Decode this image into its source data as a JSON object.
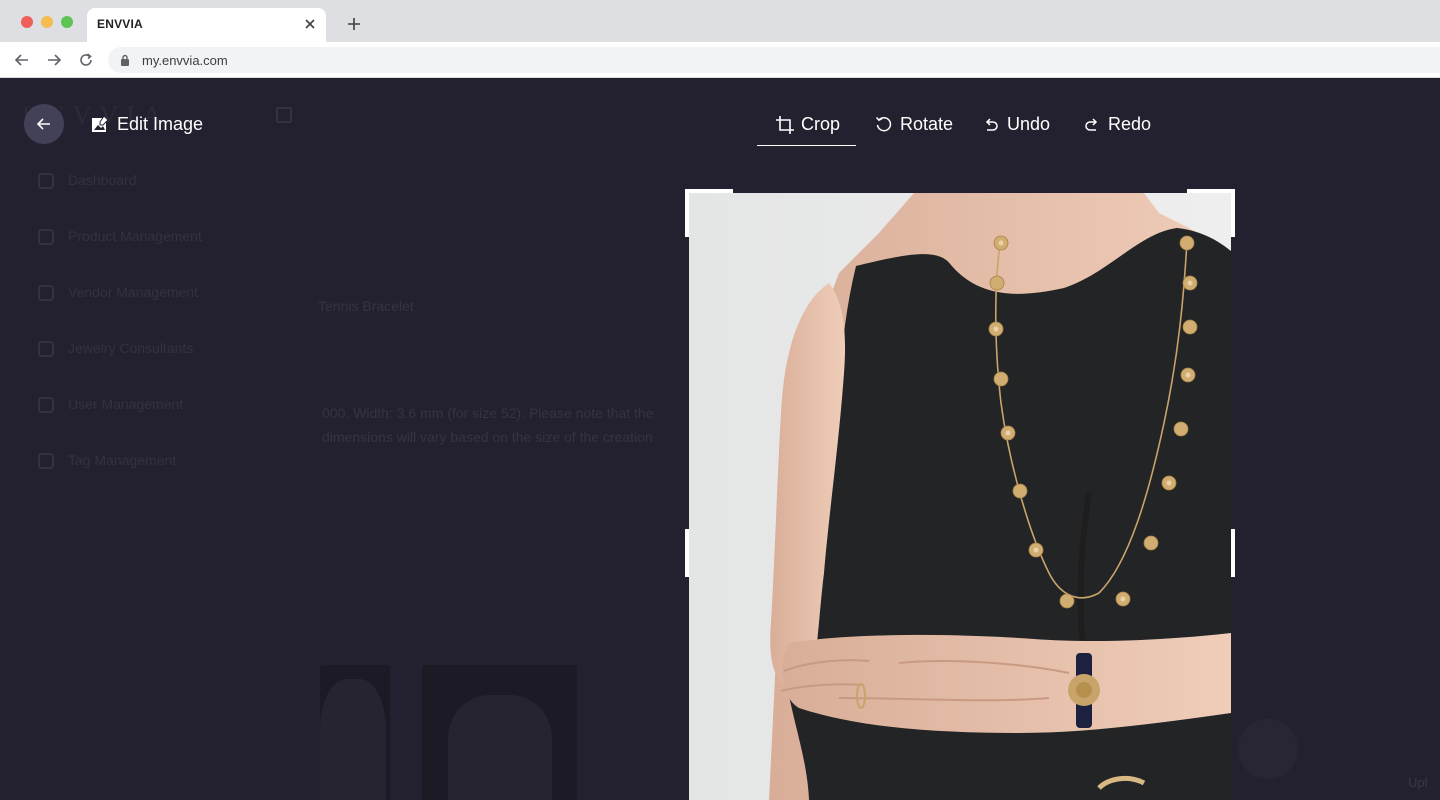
{
  "browser": {
    "tab_title": "ENVVIA",
    "url": "my.envvia.com"
  },
  "background": {
    "logo": "ENVVIA",
    "nav": [
      {
        "label": "Dashboard"
      },
      {
        "label": "Product Management"
      },
      {
        "label": "Vendor Management"
      },
      {
        "label": "Jewelry Consultants"
      },
      {
        "label": "User Management"
      },
      {
        "label": "Tag Management"
      }
    ],
    "product_name_fragment": "Tennis Bracelet",
    "description_line1": "000. Width: 3.6 mm (for size 52). Please note that the",
    "description_line2": "dimensions will vary based on the size of the creation",
    "upload_fragment": "Upl"
  },
  "editor": {
    "title": "Edit Image",
    "tools": {
      "crop": "Crop",
      "rotate": "Rotate",
      "undo": "Undo",
      "redo": "Redo"
    },
    "active_tool": "crop"
  },
  "colors": {
    "overlay_bg": "#232130",
    "back_button_bg": "#434158",
    "text": "#ffffff",
    "necklace_gold": "#c9a46a"
  }
}
